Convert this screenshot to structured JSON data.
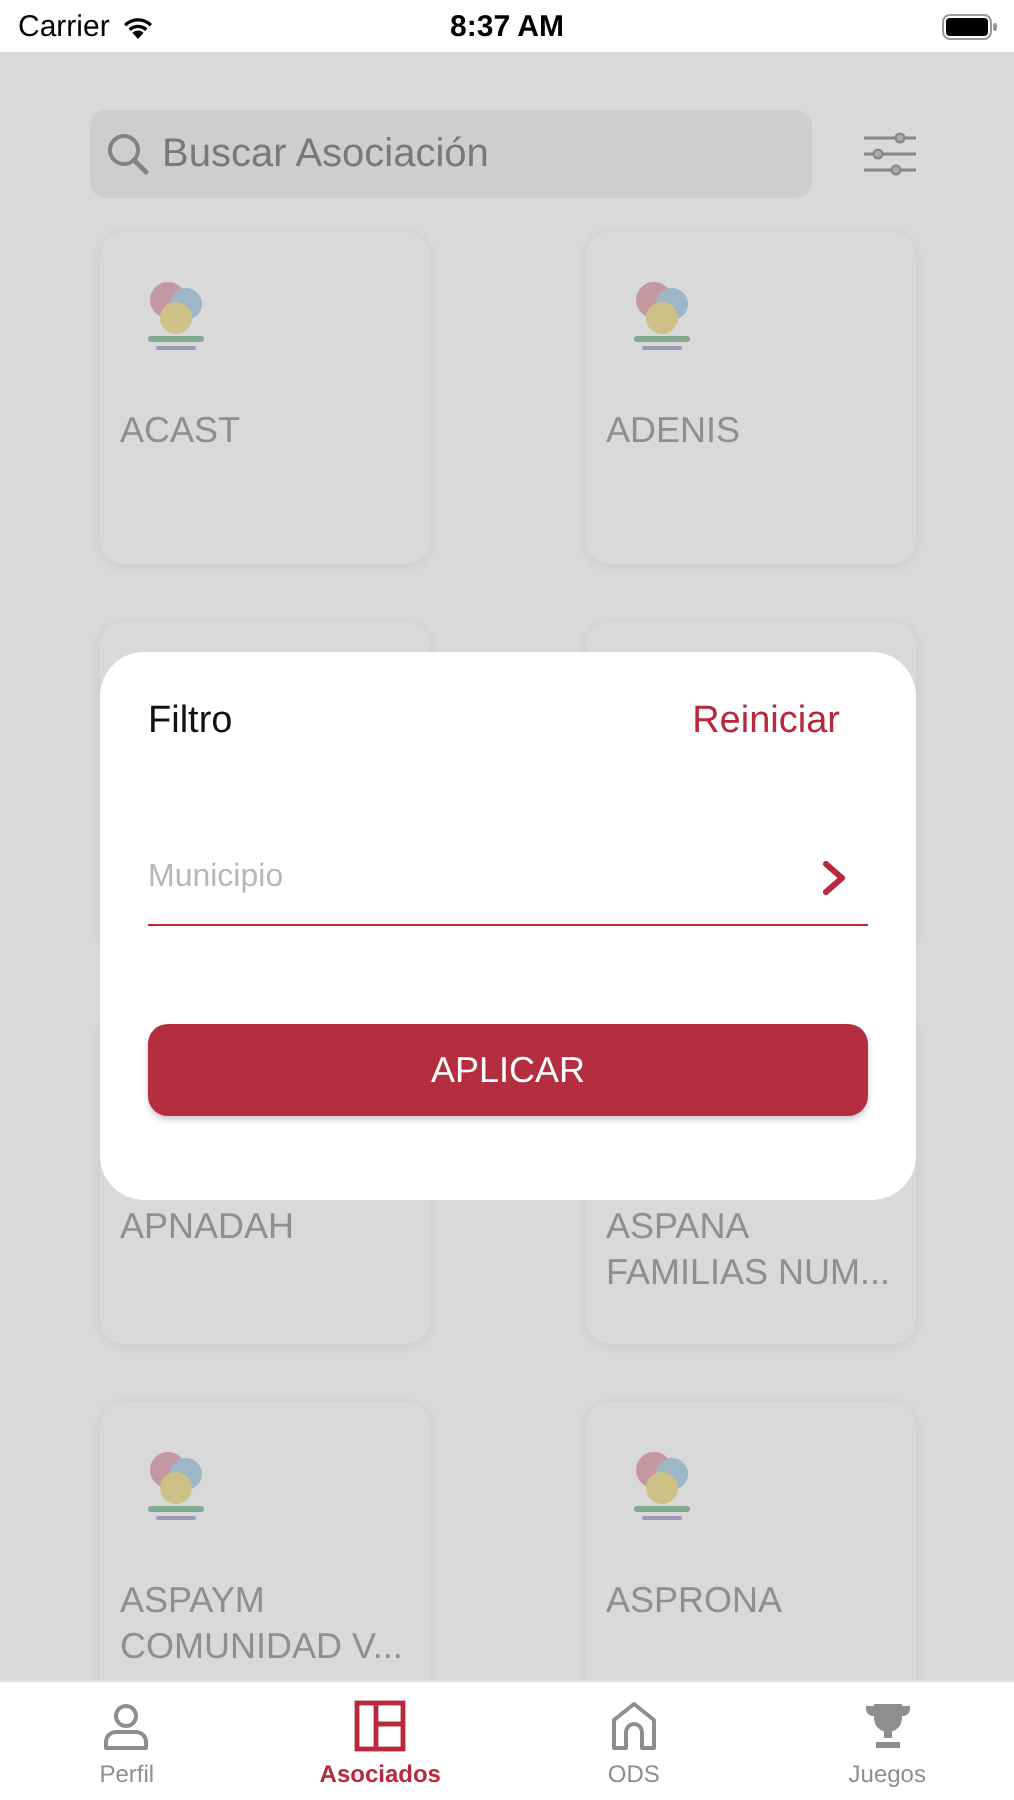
{
  "status_bar": {
    "carrier": "Carrier",
    "time": "8:37 AM"
  },
  "search": {
    "placeholder": "Buscar Asociación"
  },
  "cards": [
    {
      "kind": "card",
      "name": "ACAST"
    },
    {
      "kind": "card",
      "name": "ADENIS"
    },
    {
      "kind": "card"
    },
    {
      "kind": "card"
    },
    {
      "kind": "card",
      "name": "APNADAH"
    },
    {
      "kind": "card",
      "name": "ASPANA FAMILIAS NUM..."
    },
    {
      "kind": "card",
      "name": "ASPAYM COMUNIDAD V..."
    },
    {
      "kind": "card",
      "name": "ASPRONA"
    }
  ],
  "filter_dialog": {
    "title": "Filtro",
    "reset": "Reiniciar",
    "field": {
      "placeholder": "Municipio"
    },
    "apply": "APLICAR"
  },
  "tabs": [
    {
      "label": "Perfil",
      "selected": false
    },
    {
      "label": "Asociados",
      "selected": true
    },
    {
      "label": "ODS",
      "selected": false
    },
    {
      "label": "Juegos",
      "selected": false
    }
  ]
}
